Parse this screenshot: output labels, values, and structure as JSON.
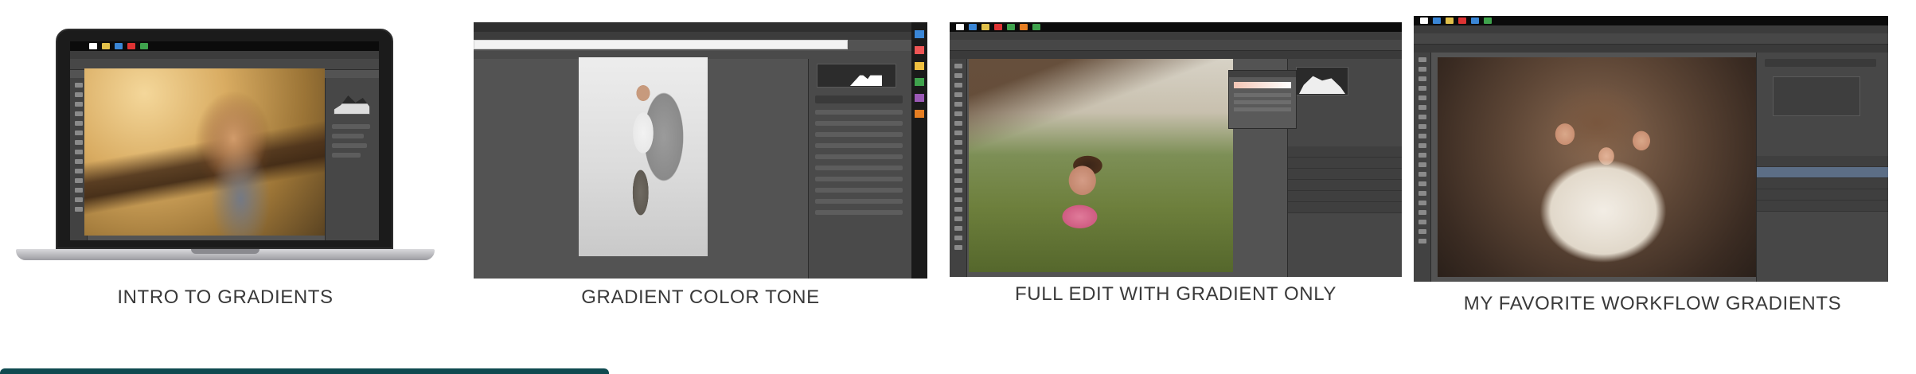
{
  "cards": [
    {
      "caption": "INTRO TO GRADIENTS",
      "thumbnail": "laptop-photoshop-girl-dandelion"
    },
    {
      "caption": "GRADIENT COLOR TONE",
      "thumbnail": "photoshop-boy-sunglasses"
    },
    {
      "caption": "FULL EDIT WITH GRADIENT ONLY",
      "thumbnail": "photoshop-girl-field"
    },
    {
      "caption": "MY FAVORITE WORKFLOW GRADIENTS",
      "thumbnail": "photoshop-three-girls"
    }
  ],
  "colors": {
    "caption_text": "#3a3a3a",
    "teal_bar": "#0f4a50",
    "ps_background": "#535353"
  }
}
